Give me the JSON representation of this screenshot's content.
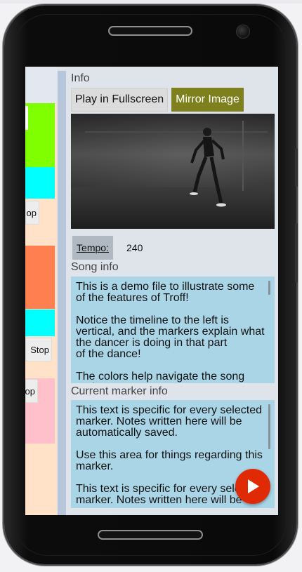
{
  "timeline": {
    "stop_buttons": [
      {
        "label": "op"
      },
      {
        "label": "Stop"
      },
      {
        "label": "op"
      }
    ]
  },
  "info": {
    "heading": "Info",
    "fullscreen_label": "Play in Fullscreen",
    "mirror_label": "Mirror Image",
    "tempo_label": "Tempo:",
    "tempo_value": "240"
  },
  "song_info": {
    "heading": "Song info",
    "paragraphs": [
      "This is a demo file to illustrate some of the features of Troff!",
      "Notice the timeline to the left is vertical, and the markers explain what the dancer is doing in that part\nof the dance!",
      "The colors help navigate the song and"
    ]
  },
  "marker_info": {
    "heading": "Current marker info",
    "paragraphs": [
      "This text is specific for every selected marker. Notes written here will be automatically saved.",
      "Use this area for things regarding this marker.",
      "This text is specific for every selected marker. Notes written here will be"
    ]
  },
  "colors": {
    "mirror_button": "#7d801c",
    "play_button": "#e02a06",
    "textbox_bg": "#aad5e6",
    "marker_green": "#80ff00",
    "marker_cyan": "#00ffff",
    "marker_orange": "#ff7f50",
    "marker_pink": "#ffc0cb"
  },
  "icons": {
    "play": "play-icon"
  }
}
